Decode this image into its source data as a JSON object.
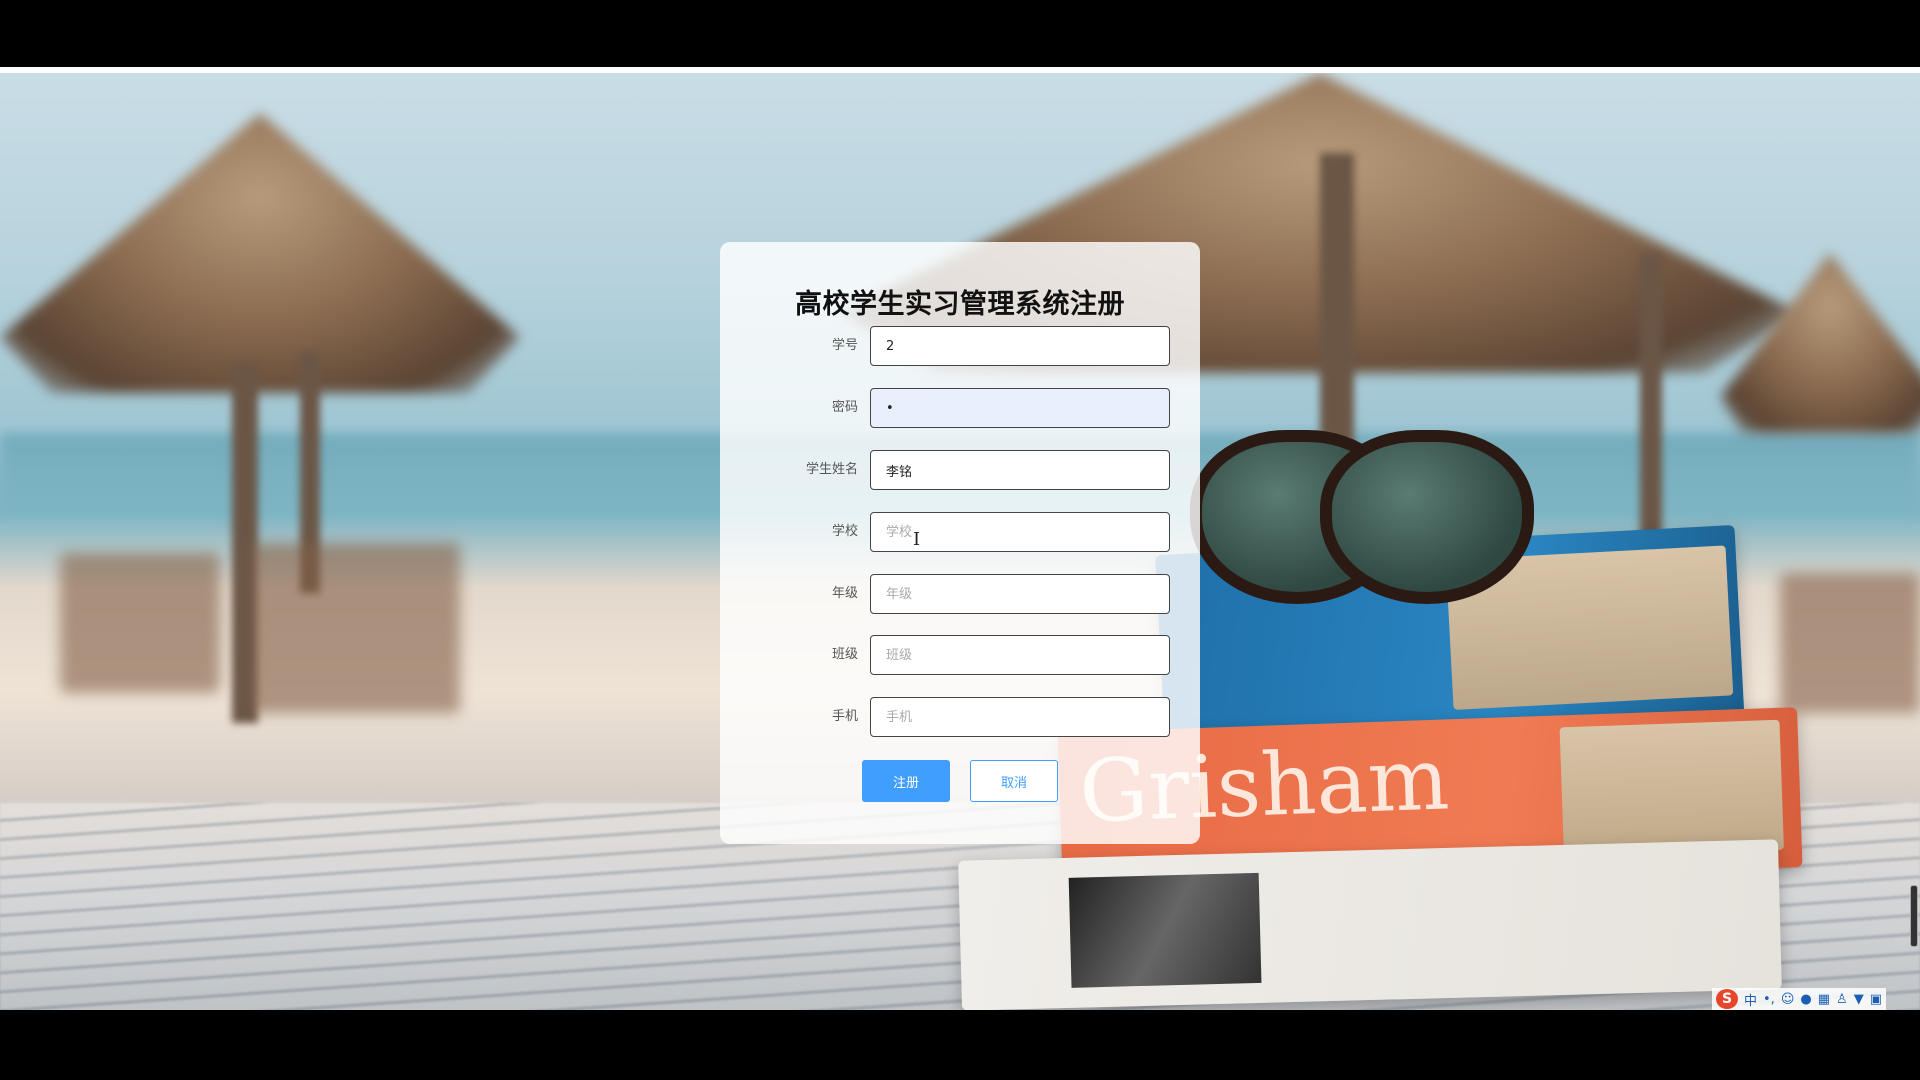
{
  "form": {
    "title": "高校学生实习管理系统注册",
    "fields": [
      {
        "label": "学号",
        "value": "2",
        "placeholder": "",
        "type": "text"
      },
      {
        "label": "密码",
        "value": "•",
        "placeholder": "",
        "type": "password"
      },
      {
        "label": "学生姓名",
        "value": "李铭",
        "placeholder": "",
        "type": "text"
      },
      {
        "label": "学校",
        "value": "",
        "placeholder": "学校",
        "type": "text"
      },
      {
        "label": "年级",
        "value": "",
        "placeholder": "年级",
        "type": "text"
      },
      {
        "label": "班级",
        "value": "",
        "placeholder": "班级",
        "type": "text"
      },
      {
        "label": "手机",
        "value": "",
        "placeholder": "手机",
        "type": "text"
      }
    ],
    "register_label": "注册",
    "cancel_label": "取消"
  },
  "background": {
    "book_title": "Grisham"
  },
  "ime": {
    "logo": "S",
    "mode": "中",
    "punct": "•,",
    "icons": [
      "emoji-icon",
      "microphone-icon",
      "keyboard-icon",
      "user-icon",
      "shirt-icon",
      "grid-icon"
    ]
  },
  "colors": {
    "primary": "#409eff",
    "autofill": "#e8f0fe"
  }
}
